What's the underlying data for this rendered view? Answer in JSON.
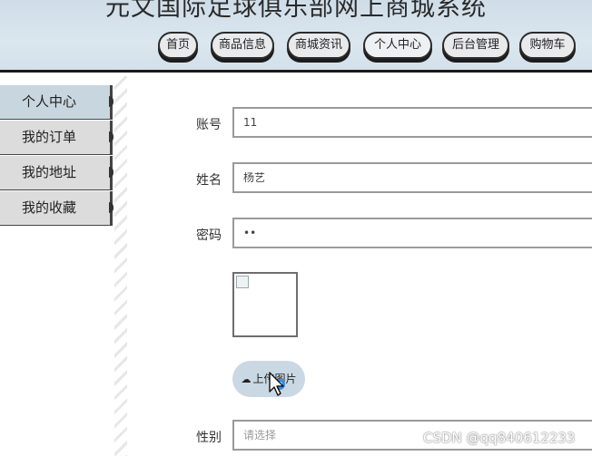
{
  "header": {
    "site_title": "元文国际足球俱乐部网上商城系统",
    "nav": [
      {
        "label": "首页"
      },
      {
        "label": "商品信息"
      },
      {
        "label": "商城资讯"
      },
      {
        "label": "个人中心"
      },
      {
        "label": "后台管理"
      },
      {
        "label": "购物车"
      }
    ],
    "active_nav": "个人中心"
  },
  "sidebar": {
    "items": [
      {
        "label": "个人中心"
      },
      {
        "label": "我的订单"
      },
      {
        "label": "我的地址"
      },
      {
        "label": "我的收藏"
      }
    ],
    "active": "个人中心"
  },
  "form": {
    "account_label": "账号",
    "account_value": "11",
    "name_label": "姓名",
    "name_value": "杨艺",
    "password_label": "密码",
    "password_value": "••",
    "upload_label": "上传图片",
    "gender_label": "性别",
    "gender_placeholder": "请选择"
  },
  "icons": {
    "upload": "cloud-upload-icon",
    "image": "broken-image-icon"
  },
  "colors": {
    "header_bg": "#d4e1ea",
    "sidebar_active_bg": "#c8d6df",
    "sidebar_bg": "#dcdcdc",
    "upload_button_bg": "#c9d8e3"
  },
  "watermark": "CSDN @qq840612233"
}
